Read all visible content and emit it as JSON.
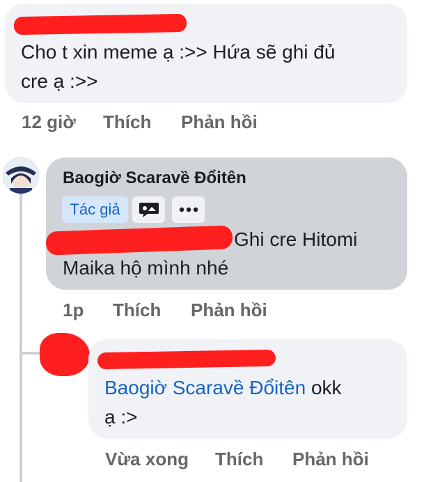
{
  "comment1": {
    "text_line1": "Cho t xin meme ạ :>> Hứa sẽ ghi đủ",
    "text_line2": "cre ạ :>>",
    "time": "12 giờ",
    "like": "Thích",
    "reply": "Phản hồi"
  },
  "comment2": {
    "author": "Baogiờ Scaravȅ Đổitên",
    "badge": "Tác giả",
    "text_line1": "Ghi cre Hitomi",
    "text_line2": "Maika hộ mình nhé",
    "time": "1p",
    "like": "Thích",
    "reply": "Phản hồi"
  },
  "comment3": {
    "mention": "Baogiờ Scaravȅ Đổitên",
    "text_after": " okk",
    "text_line2": "ạ :>",
    "time": "Vừa xong",
    "like": "Thích",
    "reply": "Phản hồi"
  },
  "icons": {
    "comment2_icon1": "chat-bubble-icon",
    "comment2_icon2": "more-icon"
  },
  "colors": {
    "redaction": "#ff1f1f",
    "link": "#1565c0",
    "meta": "#65676b"
  }
}
